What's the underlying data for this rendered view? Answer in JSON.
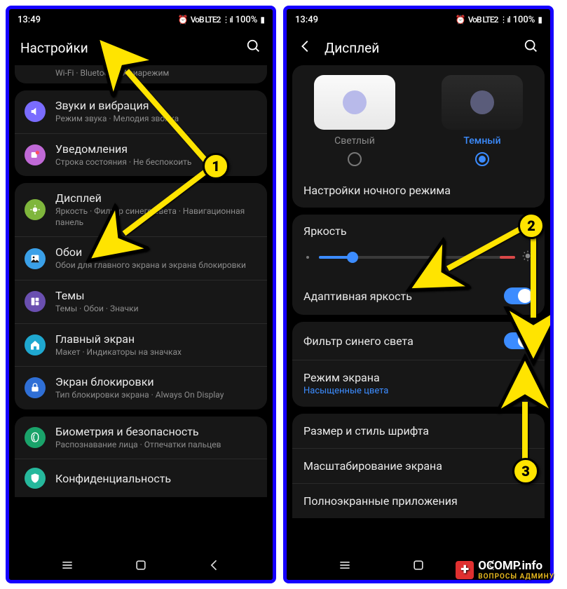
{
  "statusbar": {
    "time": "13:49",
    "battery": "100%",
    "net": "VoB  LTE2  ⋮ıl"
  },
  "phone1": {
    "header": {
      "title": "Настройки"
    },
    "partial_top": "Wi-Fi  ·  Bluetooth  ·  Авиарежим",
    "rows": [
      {
        "key": "sound",
        "title": "Звуки и вибрация",
        "sub": "Режим звука  ·  Мелодия звонка",
        "color": "#7a6cff"
      },
      {
        "key": "notif",
        "title": "Уведомления",
        "sub": "Строка состояния  ·  Не беспокоить",
        "color": "#c069d6"
      },
      {
        "key": "display",
        "title": "Дисплей",
        "sub": "Яркость  ·  Фильтр синего света  ·  Навигационная панель",
        "color": "#7fb63c"
      },
      {
        "key": "wall",
        "title": "Обои",
        "sub": "Обои для главного экрана и экрана блокировки",
        "color": "#3aa0e8"
      },
      {
        "key": "themes",
        "title": "Темы",
        "sub": "Темы  ·  Обои  ·  Значки",
        "color": "#6a4fb0"
      },
      {
        "key": "home",
        "title": "Главный экран",
        "sub": "Макет  ·  Индикаторы на значках",
        "color": "#1fa8d0"
      },
      {
        "key": "lock",
        "title": "Экран блокировки",
        "sub": "Тип блокировки экрана  ·  Always On Display",
        "color": "#2f6fd6"
      },
      {
        "key": "bio",
        "title": "Биометрия и безопасность",
        "sub": "Распознавание лица  ·  Отпечатки пальцев",
        "color": "#1aa36a"
      },
      {
        "key": "priv",
        "title": "Конфиденциальность",
        "sub": "",
        "color": "#26b89c"
      }
    ]
  },
  "phone2": {
    "header": {
      "title": "Дисплей"
    },
    "themes": {
      "light": "Светлый",
      "dark": "Темный"
    },
    "night_settings": "Настройки ночного режима",
    "brightness": "Яркость",
    "adaptive": "Адаптивная яркость",
    "bluefilter": "Фильтр синего света",
    "screenmode": {
      "title": "Режим экрана",
      "sub": "Насыщенные цвета"
    },
    "font": "Размер и стиль шрифта",
    "zoom": "Масштабирование экрана",
    "fullscreen": "Полноэкранные приложения"
  },
  "markers": {
    "m1": "1",
    "m2": "2",
    "m3": "3"
  },
  "watermark": {
    "main": "OCOMP.info",
    "sub": "ВОПРОСЫ АДМИНУ"
  }
}
